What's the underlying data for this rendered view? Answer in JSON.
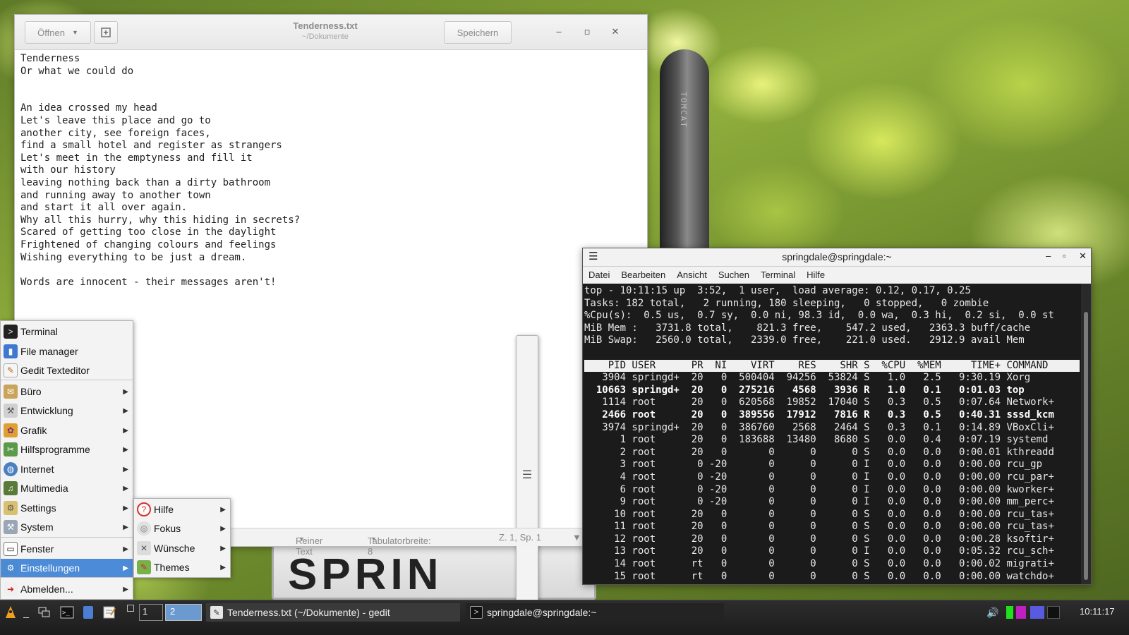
{
  "gedit": {
    "open_label": "Öffnen",
    "save_label": "Speichern",
    "title": "Tenderness.txt",
    "subtitle": "~/Dokumente",
    "content": "Tenderness\nOr what we could do\n\n\nAn idea crossed my head\nLet's leave this place and go to\nanother city, see foreign faces,\nfind a small hotel and register as strangers\nLet's meet in the emptyness and fill it\nwith our history\nleaving nothing back than a dirty bathroom\nand running away to another town\nand start it all over again.\nWhy all this hurry, why this hiding in secrets?\nScared of getting too close in the daylight\nFrightened of changing colours and feelings\nWishing everything to be just a dream.\n\nWords are innocent - their messages aren't!",
    "status_mode": "Reiner Text",
    "status_tab": "Tabulatorbreite: 8",
    "status_pos": "Z. 1, Sp. 1"
  },
  "terminal": {
    "title": "springdale@springdale:~",
    "menu": [
      "Datei",
      "Bearbeiten",
      "Ansicht",
      "Suchen",
      "Terminal",
      "Hilfe"
    ],
    "summary": [
      "top - 10:11:15 up  3:52,  1 user,  load average: 0.12, 0.17, 0.25",
      "Tasks: 182 total,   2 running, 180 sleeping,   0 stopped,   0 zombie",
      "%Cpu(s):  0.5 us,  0.7 sy,  0.0 ni, 98.3 id,  0.0 wa,  0.3 hi,  0.2 si,  0.0 st",
      "MiB Mem :   3731.8 total,    821.3 free,    547.2 used,   2363.3 buff/cache",
      "MiB Swap:   2560.0 total,   2339.0 free,    221.0 used.   2912.9 avail Mem"
    ],
    "header": "    PID USER      PR  NI    VIRT    RES    SHR S  %CPU  %MEM     TIME+ COMMAND   ",
    "rows": [
      {
        "text": "   3904 springd+  20   0  500404  94256  53824 S   1.0   2.5   9:30.19 Xorg",
        "bold": false
      },
      {
        "text": "  10663 springd+  20   0  275216   4568   3936 R   1.0   0.1   0:01.03 top",
        "bold": true
      },
      {
        "text": "   1114 root      20   0  620568  19852  17040 S   0.3   0.5   0:07.64 Network+",
        "bold": false
      },
      {
        "text": "   2466 root      20   0  389556  17912   7816 R   0.3   0.5   0:40.31 sssd_kcm",
        "bold": true
      },
      {
        "text": "   3974 springd+  20   0  386760   2568   2464 S   0.3   0.1   0:14.89 VBoxCli+",
        "bold": false
      },
      {
        "text": "      1 root      20   0  183688  13480   8680 S   0.0   0.4   0:07.19 systemd",
        "bold": false
      },
      {
        "text": "      2 root      20   0       0      0      0 S   0.0   0.0   0:00.01 kthreadd",
        "bold": false
      },
      {
        "text": "      3 root       0 -20       0      0      0 I   0.0   0.0   0:00.00 rcu_gp",
        "bold": false
      },
      {
        "text": "      4 root       0 -20       0      0      0 I   0.0   0.0   0:00.00 rcu_par+",
        "bold": false
      },
      {
        "text": "      6 root       0 -20       0      0      0 I   0.0   0.0   0:00.00 kworker+",
        "bold": false
      },
      {
        "text": "      9 root       0 -20       0      0      0 I   0.0   0.0   0:00.00 mm_perc+",
        "bold": false
      },
      {
        "text": "     10 root      20   0       0      0      0 S   0.0   0.0   0:00.00 rcu_tas+",
        "bold": false
      },
      {
        "text": "     11 root      20   0       0      0      0 S   0.0   0.0   0:00.00 rcu_tas+",
        "bold": false
      },
      {
        "text": "     12 root      20   0       0      0      0 S   0.0   0.0   0:00.28 ksoftir+",
        "bold": false
      },
      {
        "text": "     13 root      20   0       0      0      0 I   0.0   0.0   0:05.32 rcu_sch+",
        "bold": false
      },
      {
        "text": "     14 root      rt   0       0      0      0 S   0.0   0.0   0:00.02 migrati+",
        "bold": false
      },
      {
        "text": "     15 root      rt   0       0      0      0 S   0.0   0.0   0:00.00 watchdo+",
        "bold": false
      }
    ]
  },
  "menu": {
    "items": [
      {
        "label": "Terminal",
        "icon": "terminal-icon",
        "arrow": false
      },
      {
        "label": "File manager",
        "icon": "file-manager-icon",
        "arrow": false
      },
      {
        "label": "Gedit Texteditor",
        "icon": "text-editor-icon",
        "arrow": false
      },
      {
        "label": "Büro",
        "icon": "office-icon",
        "arrow": true
      },
      {
        "label": "Entwicklung",
        "icon": "development-icon",
        "arrow": true
      },
      {
        "label": "Grafik",
        "icon": "graphics-icon",
        "arrow": true
      },
      {
        "label": "Hilfsprogramme",
        "icon": "utilities-icon",
        "arrow": true
      },
      {
        "label": "Internet",
        "icon": "internet-icon",
        "arrow": true
      },
      {
        "label": "Multimedia",
        "icon": "multimedia-icon",
        "arrow": true
      },
      {
        "label": "Settings",
        "icon": "settings-icon",
        "arrow": true
      },
      {
        "label": "System",
        "icon": "system-icon",
        "arrow": true
      },
      {
        "label": "Fenster",
        "icon": "window-icon",
        "arrow": true
      },
      {
        "label": "Einstellungen",
        "icon": "preferences-icon",
        "arrow": true
      },
      {
        "label": "Abmelden...",
        "icon": "logout-icon",
        "arrow": true
      }
    ],
    "submenu": [
      {
        "label": "Hilfe",
        "icon": "help-icon"
      },
      {
        "label": "Fokus",
        "icon": "focus-icon"
      },
      {
        "label": "Wünsche",
        "icon": "tools-icon"
      },
      {
        "label": "Themes",
        "icon": "themes-icon"
      }
    ]
  },
  "taskbar": {
    "pager_1": "1",
    "pager_2": "2",
    "task_gedit": "Tenderness.txt (~/Dokumente) - gedit",
    "task_terminal": "springdale@springdale:~",
    "clock": "10:11:17"
  }
}
